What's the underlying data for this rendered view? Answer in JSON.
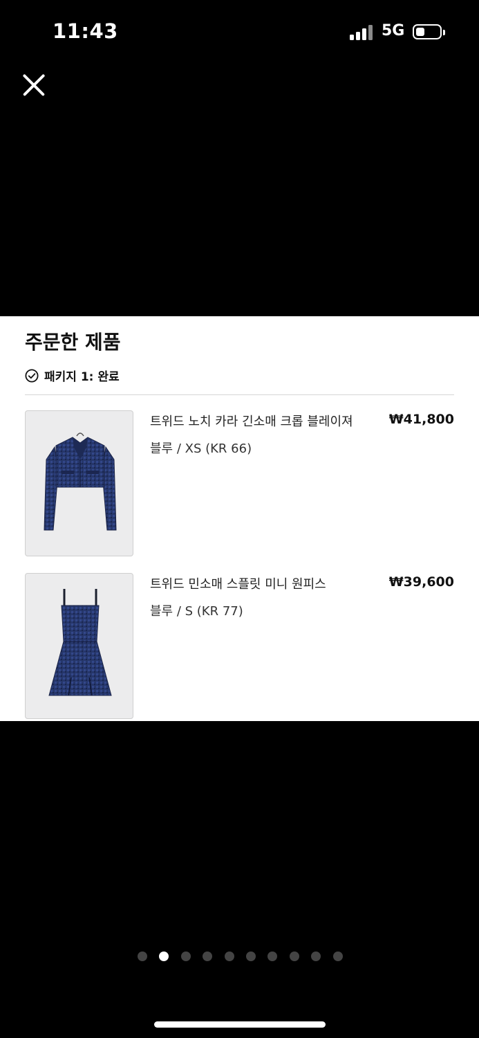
{
  "status_bar": {
    "time": "11:43",
    "network": "5G"
  },
  "close_icon": "close-icon",
  "order": {
    "section_title": "주문한 제품",
    "package_label": "패키지 1: 완료",
    "items": [
      {
        "name": "트위드 노치 카라 긴소매 크롭 블레이져",
        "variant": "블루 / XS (KR 66)",
        "price": "₩41,800",
        "image": "tweed-cropped-blazer-image"
      },
      {
        "name": "트위드 민소매 스플릿 미니 원피스",
        "variant": "블루 / S (KR 77)",
        "price": "₩39,600",
        "image": "tweed-mini-dress-image"
      }
    ]
  },
  "carousel": {
    "page_count": 10,
    "active_index": 1
  },
  "colors": {
    "background": "#000000",
    "card": "#ffffff",
    "tweed_navy": "#2a3a6e"
  }
}
